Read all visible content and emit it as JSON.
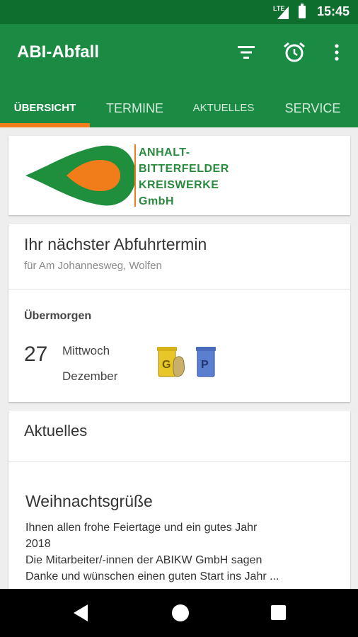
{
  "status_bar": {
    "time": "15:45",
    "network": "LTE"
  },
  "app_bar": {
    "title": "ABI-Abfall"
  },
  "tabs": [
    {
      "label": "ÜBERSICHT"
    },
    {
      "label": "TERMINE"
    },
    {
      "label": "AKTUELLES"
    },
    {
      "label": "SERVICE"
    }
  ],
  "logo": {
    "lines": [
      "ANHALT-",
      "BITTERFELDER",
      "KREISWERKE",
      "GmbH"
    ]
  },
  "next_pickup": {
    "heading": "Ihr nächster Abfuhrtermin",
    "location": "für  Am Johannesweg, Wolfen",
    "when": "Übermorgen",
    "day": "27",
    "weekday": "Mittwoch",
    "month": "Dezember",
    "bins": [
      {
        "letter": "G",
        "color": "#e8c62a"
      },
      {
        "letter": "P",
        "color": "#5b7fd0"
      }
    ]
  },
  "news": {
    "heading": "Aktuelles",
    "title": "Weihnachtsgrüße",
    "body": [
      "Ihnen allen frohe Feiertage und ein gutes Jahr",
      "2018",
      "Die Mitarbeiter/-innen der ABIKW GmbH sagen",
      "Danke und wünschen einen guten Start ins Jahr ..."
    ]
  },
  "colors": {
    "primary": "#1b8a42",
    "primary_dark": "#0e6e2e",
    "accent": "#f07d1a"
  }
}
